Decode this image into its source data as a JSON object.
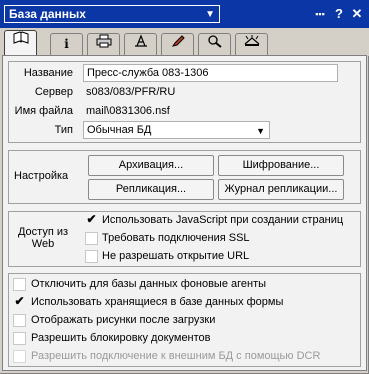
{
  "window": {
    "title": "База данных",
    "title_arrow": "▼",
    "controls": {
      "menu": "▪▪▪",
      "help": "?",
      "close": "✕"
    }
  },
  "tabs": [
    {
      "icon": "info-icon-book",
      "glyph": "📖",
      "active": true
    },
    {
      "icon": "info-icon",
      "glyph": "i"
    },
    {
      "icon": "printer-icon",
      "glyph": "⎙"
    },
    {
      "icon": "design-icon",
      "glyph": "⊼"
    },
    {
      "icon": "pen-icon",
      "glyph": "✎"
    },
    {
      "icon": "search-icon",
      "glyph": "⌕"
    },
    {
      "icon": "advanced-icon",
      "glyph": "⚒"
    }
  ],
  "general": {
    "name_label": "Название",
    "name_value": "Пресс-служба 083-1306",
    "server_label": "Сервер",
    "server_value": "s083/083/PFR/RU",
    "file_label": "Имя файла",
    "file_value": "mail\\0831306.nsf",
    "type_label": "Тип",
    "type_value": "Обычная БД",
    "type_caret": "▼"
  },
  "settings": {
    "label": "Настройка",
    "archive": "Архивация...",
    "encrypt": "Шифрование...",
    "replication": "Репликация...",
    "replication_log": "Журнал репликации..."
  },
  "web": {
    "label": "Доступ из Web",
    "opt1": "Использовать JavaScript при создании страниц",
    "opt1_checked": "✔",
    "opt2": "Требовать подключения SSL",
    "opt3": "Не разрешать открытие URL"
  },
  "options": [
    {
      "label": "Отключить для базы данных фоновые агенты",
      "checked": ""
    },
    {
      "label": "Использовать хранящиеся в базе данных формы",
      "checked": "✔"
    },
    {
      "label": "Отображать рисунки после загрузки",
      "checked": ""
    },
    {
      "label": "Разрешить блокировку документов",
      "checked": ""
    },
    {
      "label": "Разрешить подключение к внешним БД с помощью DCR",
      "checked": "",
      "disabled": true
    }
  ]
}
